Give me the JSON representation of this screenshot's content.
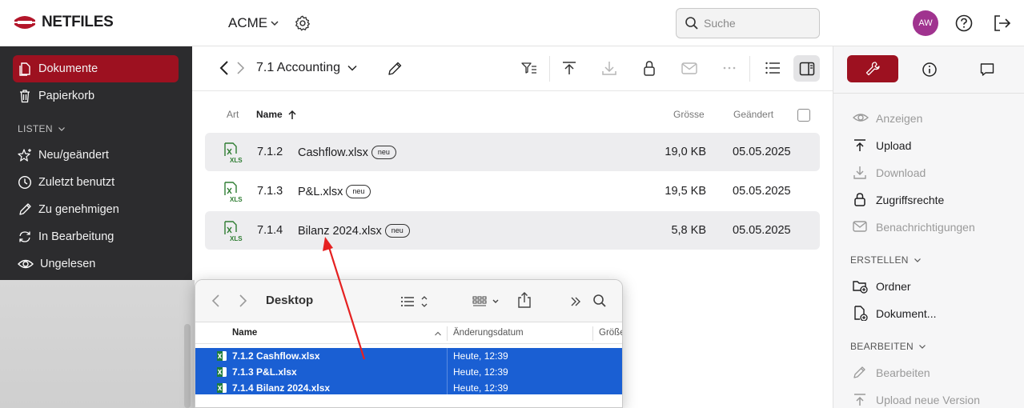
{
  "topbar": {
    "brand": "NETFILES",
    "tenant": "ACME",
    "search_placeholder": "Suche",
    "avatar_initials": "AW",
    "brand_color": "#b3162a"
  },
  "sidebar": {
    "items": [
      {
        "label": "Dokumente",
        "icon": "document-icon",
        "active": true
      },
      {
        "label": "Papierkorb",
        "icon": "trash-icon"
      }
    ],
    "section_label": "LISTEN",
    "list_items": [
      {
        "label": "Neu/geändert",
        "icon": "sparkle-star-icon"
      },
      {
        "label": "Zuletzt benutzt",
        "icon": "clock-icon"
      },
      {
        "label": "Zu genehmigen",
        "icon": "pencil-icon"
      },
      {
        "label": "In Bearbeitung",
        "icon": "refresh-icon"
      },
      {
        "label": "Ungelesen",
        "icon": "eye-icon"
      }
    ]
  },
  "main": {
    "folder_title": "7.1 Accounting",
    "columns": {
      "type": "Art",
      "name": "Name",
      "size": "Grösse",
      "modified": "Geändert"
    },
    "files": [
      {
        "number": "7.1.2",
        "name": "Cashflow.xlsx",
        "badge": "neu",
        "size": "19,0 KB",
        "date": "05.05.2025"
      },
      {
        "number": "7.1.3",
        "name": "P&L.xlsx",
        "badge": "neu",
        "size": "19,5 KB",
        "date": "05.05.2025"
      },
      {
        "number": "7.1.4",
        "name": "Bilanz 2024.xlsx",
        "badge": "neu",
        "size": "5,8 KB",
        "date": "05.05.2025"
      }
    ]
  },
  "right_panel": {
    "actions": [
      {
        "label": "Anzeigen",
        "icon": "eye-icon",
        "enabled": false
      },
      {
        "label": "Upload",
        "icon": "upload-icon",
        "enabled": true
      },
      {
        "label": "Download",
        "icon": "download-icon",
        "enabled": false
      },
      {
        "label": "Zugriffsrechte",
        "icon": "lock-icon",
        "enabled": true
      },
      {
        "label": "Benachrichtigungen",
        "icon": "mail-icon",
        "enabled": false
      }
    ],
    "create_section": "ERSTELLEN",
    "create_items": [
      {
        "label": "Ordner",
        "icon": "folder-plus-icon"
      },
      {
        "label": "Dokument...",
        "icon": "document-plus-icon"
      }
    ],
    "edit_section": "BEARBEITEN",
    "edit_items": [
      {
        "label": "Bearbeiten",
        "icon": "pencil-icon",
        "enabled": false
      },
      {
        "label": "Upload neue Version",
        "icon": "upload-icon",
        "enabled": false
      }
    ]
  },
  "finder": {
    "title": "Desktop",
    "columns": {
      "name": "Name",
      "date": "Änderungsdatum",
      "size": "Größe"
    },
    "files": [
      {
        "name": "7.1.2 Cashflow.xlsx",
        "date": "Heute, 12:39"
      },
      {
        "name": "7.1.3 P&L.xlsx",
        "date": "Heute, 12:39"
      },
      {
        "name": "7.1.4 Bilanz 2024.xlsx",
        "date": "Heute, 12:39"
      }
    ]
  }
}
